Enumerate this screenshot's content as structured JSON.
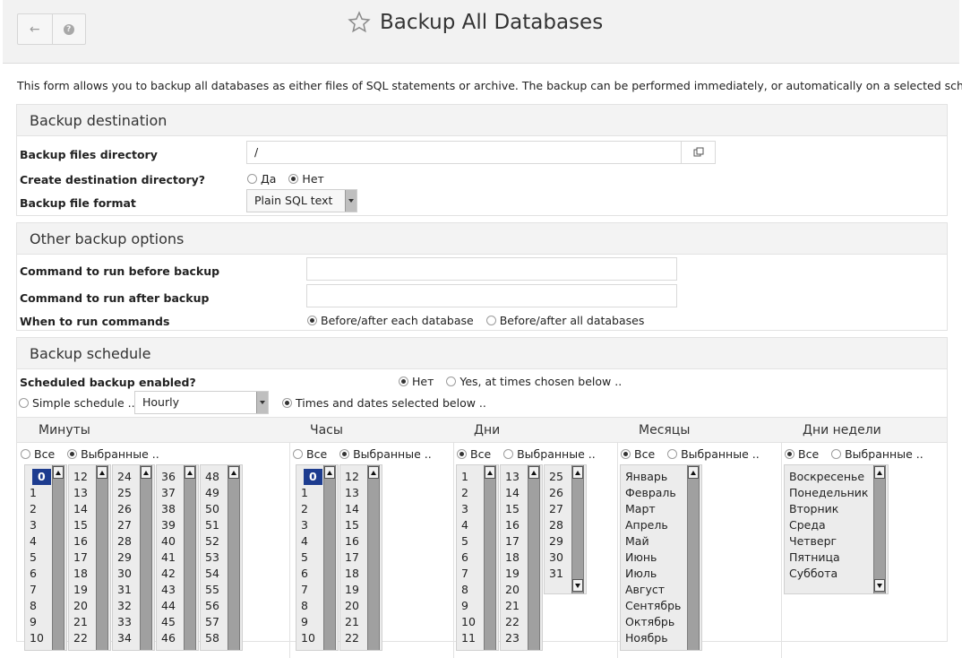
{
  "header": {
    "title": "Backup All Databases",
    "back_icon": "←",
    "help_icon": "?"
  },
  "intro_text": "This form allows you to backup all databases as either files of SQL statements or archive. The backup can be performed immediately, or automatically on a selected schedule.",
  "destination": {
    "heading": "Backup destination",
    "dir_label": "Backup files directory",
    "dir_value": "/",
    "create_dir_label": "Create destination directory?",
    "create_yes": "Да",
    "create_no": "Нет",
    "create_selected": "Нет",
    "format_label": "Backup file format",
    "format_value": "Plain SQL text"
  },
  "other": {
    "heading": "Other backup options",
    "before_label": "Command to run before backup",
    "before_value": "",
    "after_label": "Command to run after backup",
    "after_value": "",
    "when_label": "When to run commands",
    "when_each": "Before/after each database",
    "when_all": "Before/after all databases",
    "when_selected": "Before/after each database"
  },
  "schedule": {
    "heading": "Backup schedule",
    "enabled_label": "Scheduled backup enabled?",
    "enabled_no": "Нет",
    "enabled_yes": "Yes, at times chosen below ..",
    "enabled_selected": "Нет",
    "simple_label": "Simple schedule ..",
    "simple_value": "Hourly",
    "times_label": "Times and dates selected below ..",
    "mode_selected": "times",
    "all_label": "Все",
    "selected_label": "Выбранные ..",
    "columns": {
      "minutes": {
        "title": "Минуты",
        "mode": "selected",
        "lists": [
          [
            "0",
            "1",
            "2",
            "3",
            "4",
            "5",
            "6",
            "7",
            "8",
            "9",
            "10"
          ],
          [
            "12",
            "13",
            "14",
            "15",
            "16",
            "17",
            "18",
            "19",
            "20",
            "21",
            "22"
          ],
          [
            "24",
            "25",
            "26",
            "27",
            "28",
            "29",
            "30",
            "31",
            "32",
            "33",
            "34"
          ],
          [
            "36",
            "37",
            "38",
            "39",
            "40",
            "41",
            "42",
            "43",
            "44",
            "45",
            "46"
          ],
          [
            "48",
            "49",
            "50",
            "51",
            "52",
            "53",
            "54",
            "55",
            "56",
            "57",
            "58"
          ]
        ],
        "selected_value": "0"
      },
      "hours": {
        "title": "Часы",
        "mode": "selected",
        "lists": [
          [
            "0",
            "1",
            "2",
            "3",
            "4",
            "5",
            "6",
            "7",
            "8",
            "9",
            "10"
          ],
          [
            "12",
            "13",
            "14",
            "15",
            "16",
            "17",
            "18",
            "19",
            "20",
            "21",
            "22"
          ]
        ],
        "selected_value": "0"
      },
      "days": {
        "title": "Дни",
        "mode": "all",
        "lists": [
          [
            "1",
            "2",
            "3",
            "4",
            "5",
            "6",
            "7",
            "8",
            "9",
            "10",
            "11"
          ],
          [
            "13",
            "14",
            "15",
            "16",
            "17",
            "18",
            "19",
            "20",
            "21",
            "22",
            "23"
          ],
          [
            "25",
            "26",
            "27",
            "28",
            "29",
            "30",
            "31"
          ]
        ]
      },
      "months": {
        "title": "Месяцы",
        "mode": "all",
        "lists": [
          [
            "Январь",
            "Февраль",
            "Март",
            "Апрель",
            "Май",
            "Июнь",
            "Июль",
            "Август",
            "Сентябрь",
            "Октябрь",
            "Ноябрь"
          ]
        ]
      },
      "weekdays": {
        "title": "Дни недели",
        "mode": "all",
        "lists": [
          [
            "Воскресенье",
            "Понедельник",
            "Вторник",
            "Среда",
            "Четверг",
            "Пятница",
            "Суббота"
          ]
        ]
      }
    }
  }
}
